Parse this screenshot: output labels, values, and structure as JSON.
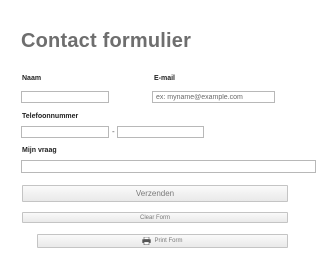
{
  "form": {
    "title": "Contact formulier",
    "name_label": "Naam",
    "name_value": "",
    "email_label": "E-mail",
    "email_placeholder": "ex: myname@example.com",
    "phone_label": "Telefoonnummer",
    "phone_area_value": "",
    "phone_separator": "-",
    "phone_number_value": "",
    "question_label": "Mijn vraag",
    "question_value": ""
  },
  "buttons": {
    "submit_label": "Verzenden",
    "clear_label": "Clear Form",
    "print_label": "Print Form",
    "print_icon": "printer-icon"
  }
}
